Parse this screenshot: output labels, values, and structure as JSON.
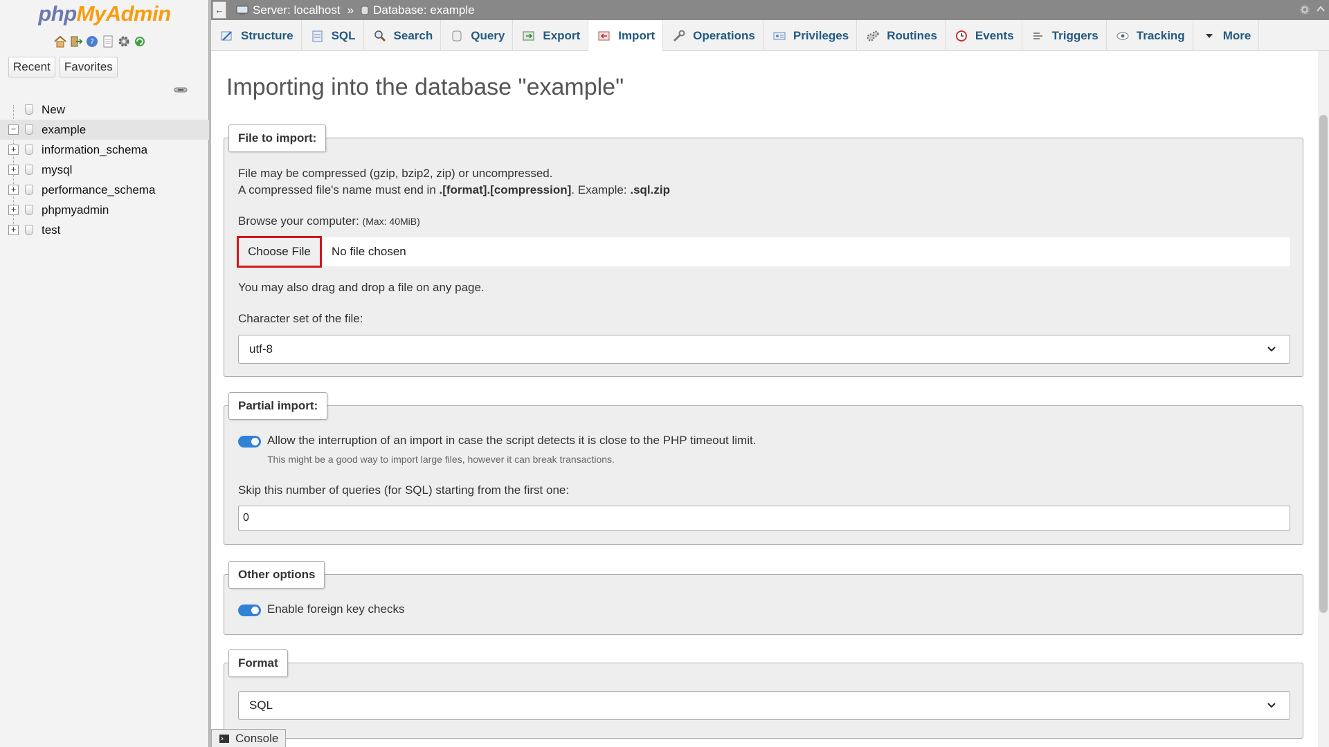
{
  "nav": {
    "logo_php": "php",
    "logo_myadmin": "MyAdmin",
    "icons": [
      "home-icon",
      "logout-icon",
      "help-icon",
      "docs-icon",
      "settings-icon",
      "reload-icon"
    ],
    "tabs": [
      "Recent",
      "Favorites"
    ],
    "tree": [
      {
        "label": "New",
        "expander": "",
        "active": false
      },
      {
        "label": "example",
        "expander": "−",
        "active": true
      },
      {
        "label": "information_schema",
        "expander": "+",
        "active": false
      },
      {
        "label": "mysql",
        "expander": "+",
        "active": false
      },
      {
        "label": "performance_schema",
        "expander": "+",
        "active": false
      },
      {
        "label": "phpmyadmin",
        "expander": "+",
        "active": false
      },
      {
        "label": "test",
        "expander": "+",
        "active": false
      }
    ]
  },
  "topbar": {
    "back": "←",
    "server": "Server: localhost",
    "separator": "»",
    "database": "Database: example"
  },
  "tabs": [
    {
      "label": "Structure",
      "icon": "structure-icon"
    },
    {
      "label": "SQL",
      "icon": "sql-icon"
    },
    {
      "label": "Search",
      "icon": "search-icon"
    },
    {
      "label": "Query",
      "icon": "query-icon"
    },
    {
      "label": "Export",
      "icon": "export-icon"
    },
    {
      "label": "Import",
      "icon": "import-icon",
      "active": true
    },
    {
      "label": "Operations",
      "icon": "wrench-icon"
    },
    {
      "label": "Privileges",
      "icon": "privileges-icon"
    },
    {
      "label": "Routines",
      "icon": "routines-icon"
    },
    {
      "label": "Events",
      "icon": "clock-icon"
    },
    {
      "label": "Triggers",
      "icon": "triggers-icon"
    },
    {
      "label": "Tracking",
      "icon": "eye-icon"
    },
    {
      "label": "More",
      "icon": "chevron-down-icon"
    }
  ],
  "main": {
    "title": "Importing into the database \"example\"",
    "file_import": {
      "legend": "File to import:",
      "line1": "File may be compressed (gzip, bzip2, zip) or uncompressed.",
      "line2_pre": "A compressed file's name must end in ",
      "line2_bold": ".[format].[compression]",
      "line2_mid": ". Example: ",
      "line2_example": ".sql.zip",
      "browse_label": "Browse your computer:",
      "browse_max": "(Max: 40MiB)",
      "choose_button": "Choose File",
      "no_file": "No file chosen",
      "drag_drop": "You may also drag and drop a file on any page.",
      "charset_label": "Character set of the file:",
      "charset_value": "utf-8"
    },
    "partial_import": {
      "legend": "Partial import:",
      "allow_interrupt": "Allow the interruption of an import in case the script detects it is close to the PHP timeout limit.",
      "allow_interrupt_hint": "This might be a good way to import large files, however it can break transactions.",
      "skip_label": "Skip this number of queries (for SQL) starting from the first one:",
      "skip_value": "0"
    },
    "other_options": {
      "legend": "Other options",
      "foreign_keys": "Enable foreign key checks"
    },
    "format": {
      "legend": "Format",
      "value": "SQL"
    }
  },
  "console": {
    "label": "Console"
  },
  "colors": {
    "accent": "#235a81",
    "highlight": "#d4141b",
    "toggle": "#2f82d6"
  }
}
